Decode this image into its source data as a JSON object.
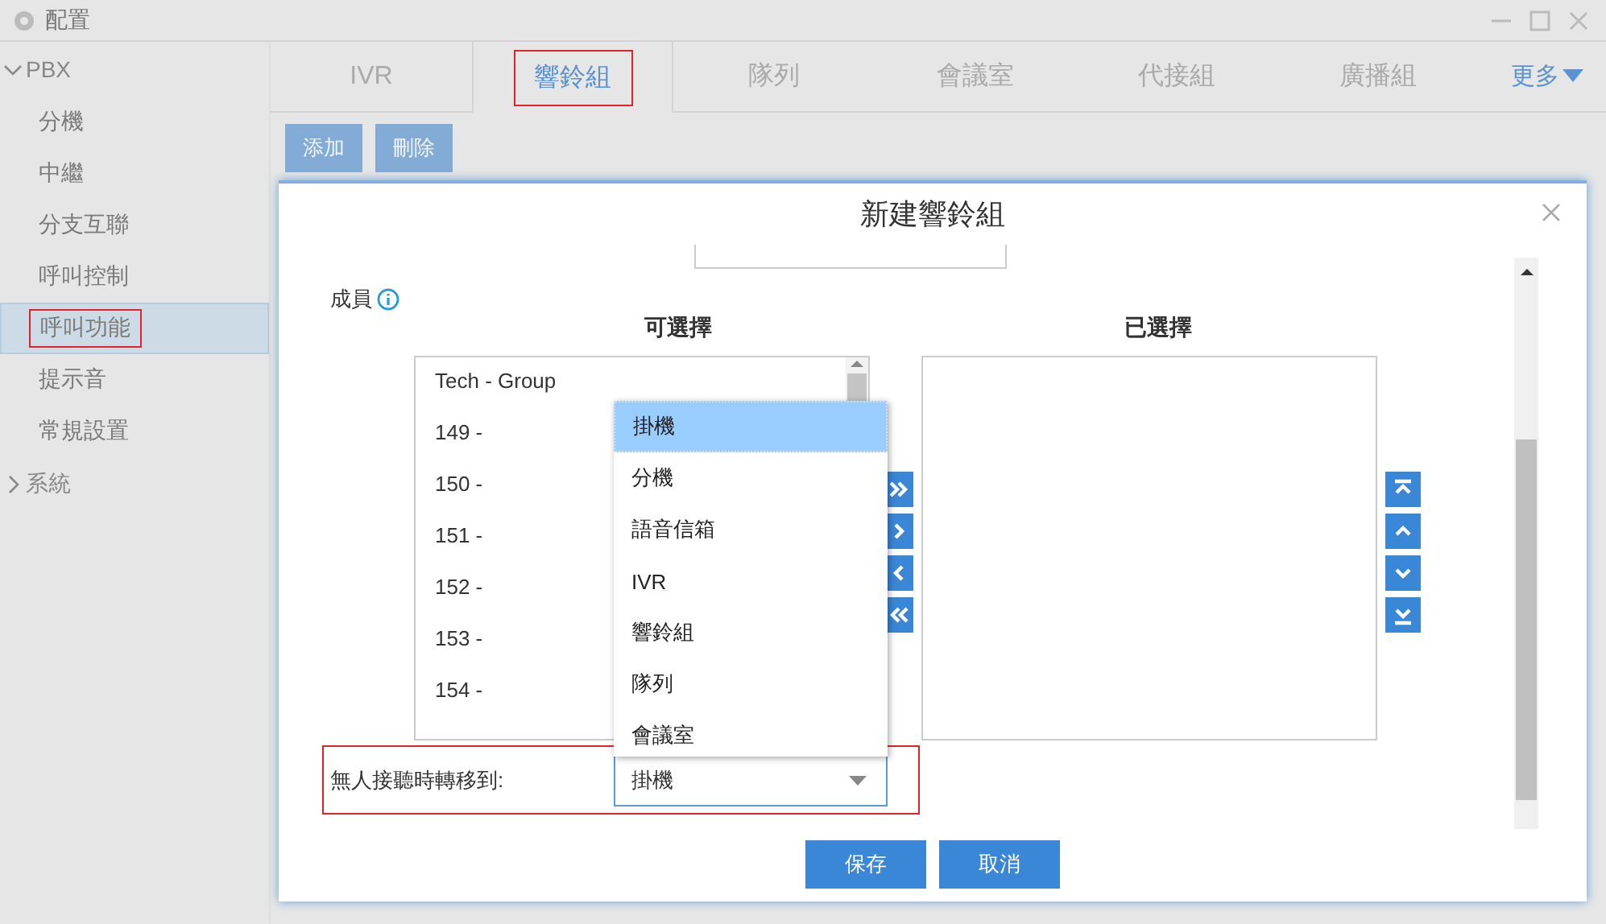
{
  "window": {
    "title": "配置"
  },
  "sidebar": {
    "groups": [
      {
        "label": "PBX",
        "expanded": true,
        "items": [
          {
            "label": "分機",
            "selected": false,
            "highlighted": false
          },
          {
            "label": "中繼",
            "selected": false,
            "highlighted": false
          },
          {
            "label": "分支互聯",
            "selected": false,
            "highlighted": false
          },
          {
            "label": "呼叫控制",
            "selected": false,
            "highlighted": false
          },
          {
            "label": "呼叫功能",
            "selected": true,
            "highlighted": true
          },
          {
            "label": "提示音",
            "selected": false,
            "highlighted": false
          },
          {
            "label": "常規設置",
            "selected": false,
            "highlighted": false
          }
        ]
      },
      {
        "label": "系統",
        "expanded": false
      }
    ]
  },
  "tabs": [
    {
      "label": "IVR",
      "selected": false,
      "highlighted": false
    },
    {
      "label": "響鈴組",
      "selected": true,
      "highlighted": true
    },
    {
      "label": "隊列",
      "selected": false,
      "highlighted": false
    },
    {
      "label": "會議室",
      "selected": false,
      "highlighted": false
    },
    {
      "label": "代接組",
      "selected": false,
      "highlighted": false
    },
    {
      "label": "廣播組",
      "selected": false,
      "highlighted": false
    }
  ],
  "more_tab": {
    "label": "更多"
  },
  "toolbar": {
    "buttons": [
      "添加",
      "刪除"
    ]
  },
  "dialog": {
    "title": "新建響鈴組",
    "members": {
      "label": "成員",
      "available": {
        "heading": "可選擇",
        "items": [
          "Tech - Group",
          "149 -",
          "150 -",
          "151 -",
          "152 -",
          "153 -",
          "154 -"
        ]
      },
      "chosen": {
        "heading": "已選擇"
      }
    },
    "transfer": {
      "label": "無人接聽時轉移到:",
      "value": "掛機",
      "expanded": true,
      "highlighted": true,
      "options": [
        {
          "label": "掛機",
          "selected": true
        },
        {
          "label": "分機",
          "selected": false
        },
        {
          "label": "語音信箱",
          "selected": false
        },
        {
          "label": "IVR",
          "selected": false
        },
        {
          "label": "響鈴組",
          "selected": false
        },
        {
          "label": "隊列",
          "selected": false
        },
        {
          "label": "會議室",
          "selected": false
        }
      ]
    },
    "buttons": [
      "保存",
      "取消"
    ]
  }
}
